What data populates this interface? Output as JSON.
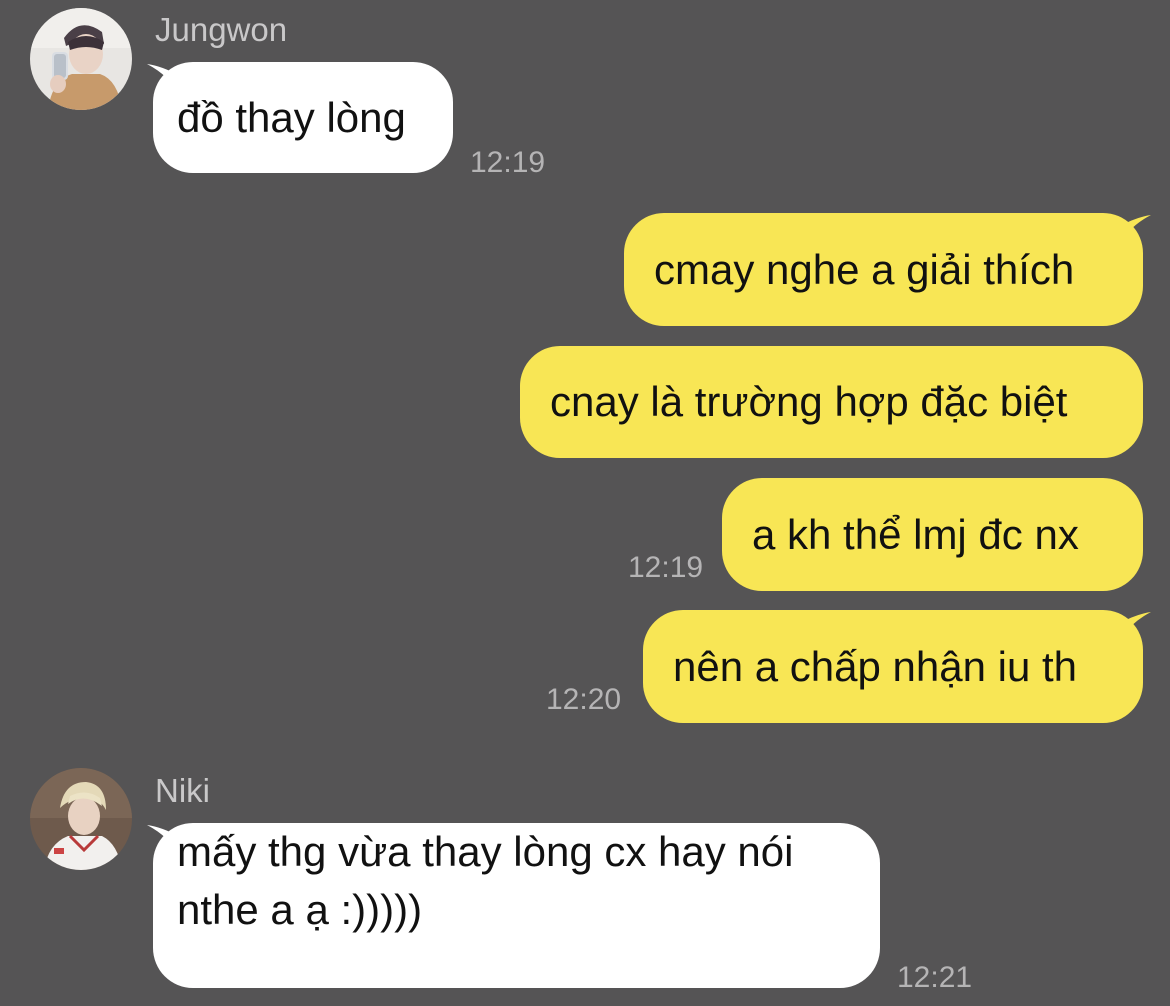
{
  "messages": [
    {
      "sender": "Jungwon",
      "text": "đồ thay lòng",
      "time": "12:19",
      "direction": "in"
    },
    {
      "text": "cmay nghe a giải thích",
      "direction": "out"
    },
    {
      "text": "cnay là trường hợp đặc biệt",
      "direction": "out"
    },
    {
      "text": "a kh thể lmj đc nx",
      "time": "12:19",
      "direction": "out"
    },
    {
      "text": "nên a chấp nhận iu th",
      "time": "12:20",
      "direction": "out"
    },
    {
      "sender": "Niki",
      "text_lines": [
        "mấy thg vừa thay lòng cx hay nói",
        "nthe a ạ :)))))"
      ],
      "time": "12:21",
      "direction": "in"
    }
  ],
  "colors": {
    "background": "#555455",
    "incoming_bubble": "#ffffff",
    "outgoing_bubble": "#f8e655",
    "sender_name": "#c9c8c9",
    "timestamp": "#b5b4b5"
  }
}
